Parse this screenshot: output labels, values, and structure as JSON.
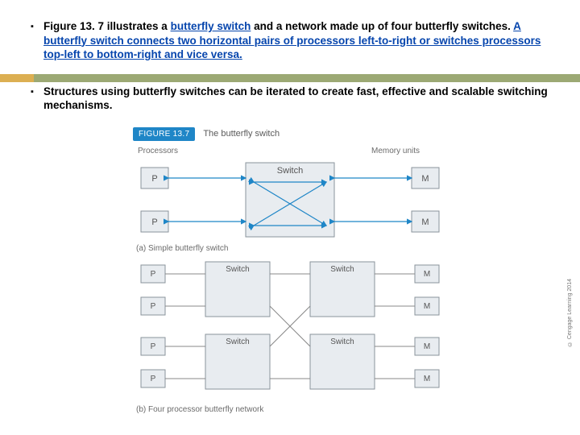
{
  "bullets": {
    "first_pre": "Figure 13. 7 illustrates a ",
    "first_link": "butterfly switch",
    "first_mid": " and a network made up of four butterfly switches. ",
    "first_tail": "A butterfly switch connects two horizontal pairs of processors left-to-right or switches processors top-left to bottom-right and vice versa.",
    "second": "Structures using butterfly switches can be iterated to create fast, effective and scalable switching mechanisms."
  },
  "figure": {
    "tag": "FIGURE 13.7",
    "title": "The butterfly switch",
    "labels": {
      "processors": "Processors",
      "memory": "Memory units"
    },
    "caption_a": "(a) Simple butterfly switch",
    "caption_b": "(b) Four processor butterfly network",
    "node": {
      "p": "P",
      "m": "M",
      "switch": "Switch"
    },
    "copyright": "© Cengage Learning 2014"
  }
}
